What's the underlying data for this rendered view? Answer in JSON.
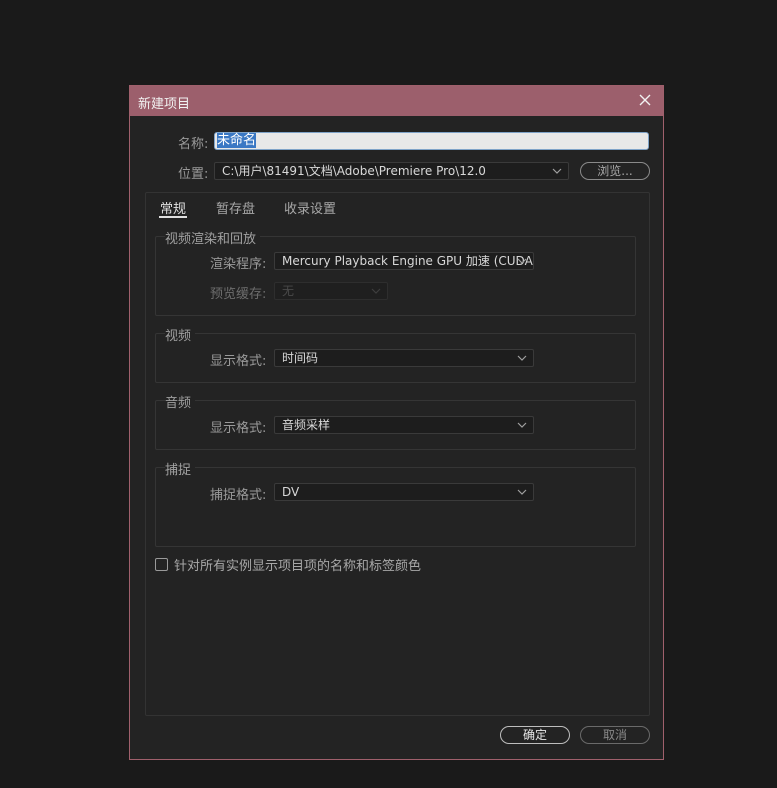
{
  "dialog": {
    "title": "新建项目",
    "close_icon": "close-icon"
  },
  "name": {
    "label": "名称:",
    "value": "未命名"
  },
  "location": {
    "label": "位置:",
    "value": "C:\\用户\\81491\\文档\\Adobe\\Premiere Pro\\12.0",
    "browse_label": "浏览..."
  },
  "tabs": [
    {
      "label": "常规",
      "active": true
    },
    {
      "label": "暂存盘",
      "active": false
    },
    {
      "label": "收录设置",
      "active": false
    }
  ],
  "video_rendering": {
    "title": "视频渲染和回放",
    "renderer_label": "渲染程序:",
    "renderer_value": "Mercury Playback Engine GPU 加速 (CUDA)",
    "preview_cache_label": "预览缓存:",
    "preview_cache_value": "无"
  },
  "video": {
    "title": "视频",
    "display_format_label": "显示格式:",
    "display_format_value": "时间码"
  },
  "audio": {
    "title": "音频",
    "display_format_label": "显示格式:",
    "display_format_value": "音频采样"
  },
  "capture": {
    "title": "捕捉",
    "capture_format_label": "捕捉格式:",
    "capture_format_value": "DV"
  },
  "checkbox": {
    "label": "针对所有实例显示项目项的名称和标签颜色",
    "checked": false
  },
  "buttons": {
    "ok_label": "确定",
    "cancel_label": "取消"
  },
  "colors": {
    "titlebar": "#9c5f6c",
    "background": "#232323",
    "page": "#1a1a1a"
  }
}
